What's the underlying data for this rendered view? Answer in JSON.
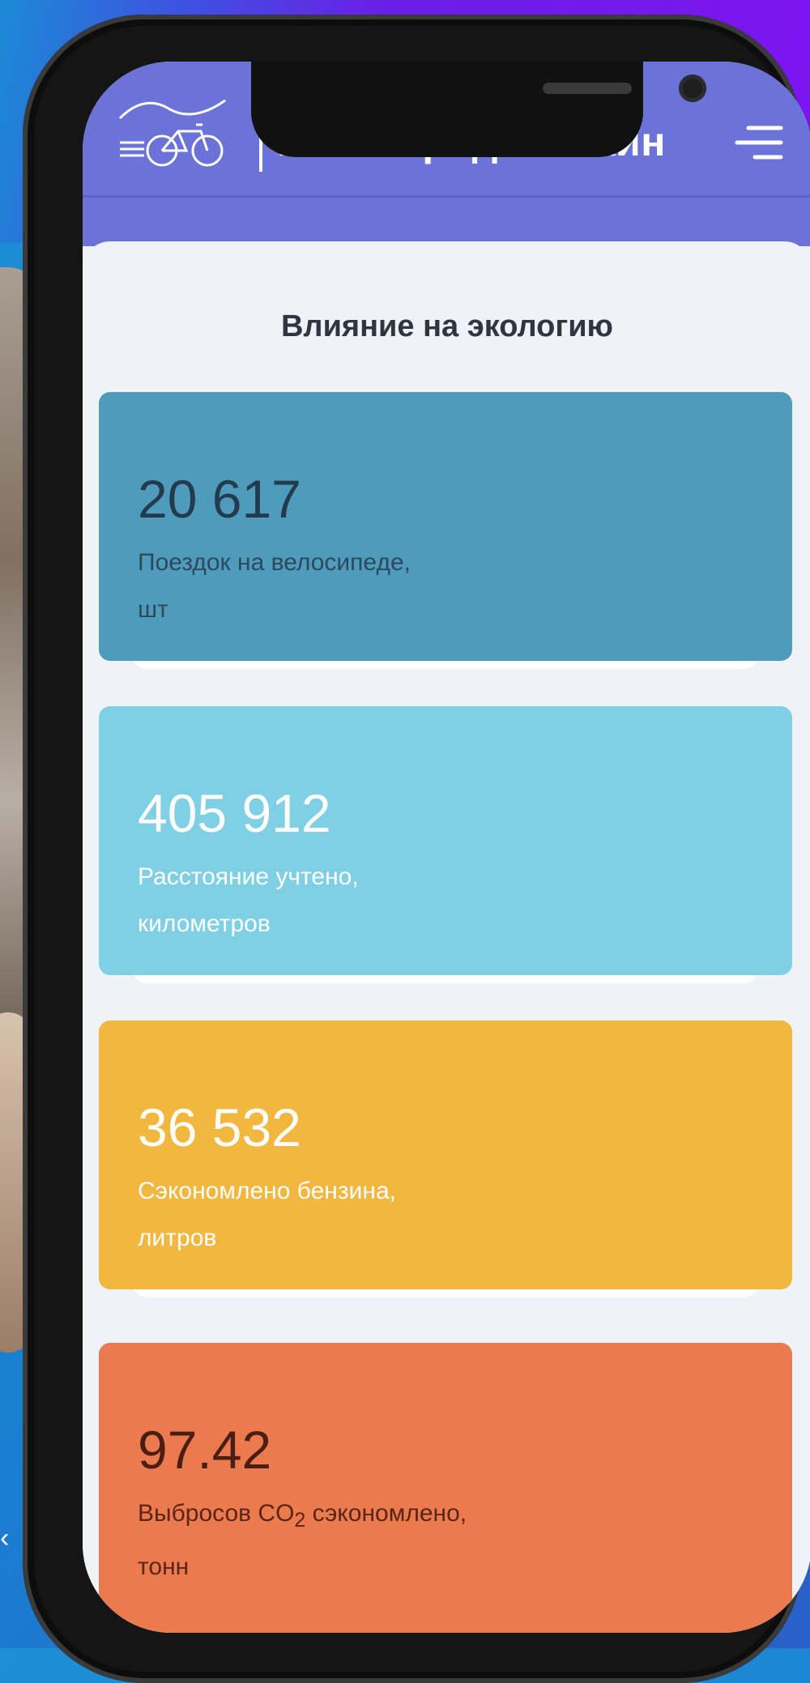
{
  "app": {
    "brand": "Велогород.Онлайн"
  },
  "section": {
    "title": "Влияние на экологию"
  },
  "stats": [
    {
      "value": "20 617",
      "label_line1": "Поездок на велосипеде,",
      "label_line2": "шт",
      "color": "#4f9bbc"
    },
    {
      "value": "405 912",
      "label_line1": "Расстояние учтено,",
      "label_line2": "километров",
      "color": "#7fd0e5"
    },
    {
      "value": "36 532",
      "label_line1": "Сэкономлено бензина,",
      "label_line2": "литров",
      "color": "#f2b73e"
    },
    {
      "value": "97.42",
      "label_line1": "Выбросов CO",
      "label_sub": "2",
      "label_line1_rest": " сэкономлено,",
      "label_line2": "тонн",
      "color": "#ec7a4f"
    }
  ],
  "icons": {
    "logo": "bike-logo-icon",
    "menu": "menu-icon"
  },
  "colors": {
    "header": "#6b73d9",
    "background_accent": "#7e14f0"
  }
}
